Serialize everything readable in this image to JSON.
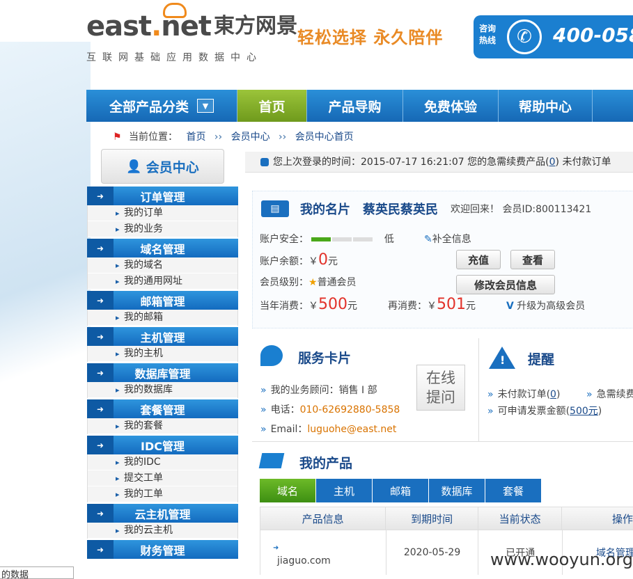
{
  "header": {
    "logo_en": "east",
    "logo_en_dot": ".",
    "logo_en_tail": "net",
    "logo_cn": "東方网景",
    "logo_sub": "互联网基础应用数据中心",
    "slogan": "轻松选择 永久陪伴",
    "hotline_label_1": "咨询",
    "hotline_label_2": "热线",
    "hotline_icon": "phone-icon",
    "hotline_number": "400-058"
  },
  "nav": {
    "items": [
      {
        "label": "全部产品分类",
        "dropdown": "▼"
      },
      {
        "label": "首页"
      },
      {
        "label": "产品导购"
      },
      {
        "label": "免费体验"
      },
      {
        "label": "帮助中心"
      }
    ]
  },
  "breadcrumb": {
    "prefix": "当前位置：",
    "items": [
      "首页",
      "会员中心",
      "会员中心首页"
    ],
    "separator": "›› "
  },
  "sidebar": {
    "title": "会员中心",
    "groups": [
      {
        "title": "订单管理",
        "items": [
          "我的订单",
          "我的业务"
        ]
      },
      {
        "title": "域名管理",
        "items": [
          "我的域名",
          "我的通用网址"
        ]
      },
      {
        "title": "邮箱管理",
        "items": [
          "我的邮箱"
        ]
      },
      {
        "title": "主机管理",
        "items": [
          "我的主机"
        ]
      },
      {
        "title": "数据库管理",
        "items": [
          "我的数据库"
        ]
      },
      {
        "title": "套餐管理",
        "items": [
          "我的套餐"
        ]
      },
      {
        "title": "IDC管理",
        "items": [
          "我的IDC",
          "提交工单",
          "我的工单"
        ]
      },
      {
        "title": "云主机管理",
        "items": [
          "我的云主机"
        ]
      },
      {
        "title": "财务管理",
        "items": []
      }
    ]
  },
  "lastlogin": {
    "text_1": "您上次登录的时间：2015-07-17 16:21:07  您的急需续费产品(",
    "renew_count": "0",
    "text_2": ")  未付款订单"
  },
  "card": {
    "title": "我的名片",
    "name": "蔡英民蔡英民",
    "welcome": "欢迎回来！ 会员ID:800113421",
    "security_label": "账户安全：",
    "security_level": "低",
    "security_fraction": 0.33,
    "complete_info": "补全信息",
    "balance_label": "账户余额：",
    "balance_currency": "￥",
    "balance_value": "0",
    "balance_unit": "元",
    "recharge_button": "充值",
    "view_button": "查看",
    "level_label": "会员级别：",
    "level_value": "普通会员",
    "modify_button": "修改会员信息",
    "year_spend_label": "当年消费：",
    "year_spend_currency": "￥",
    "year_spend_value": "500",
    "year_spend_unit": "元",
    "again_spend_label": "再消费：",
    "again_spend_currency": "￥",
    "again_spend_value": "501",
    "again_spend_unit": "元",
    "upgrade_label": "升级为高级会员",
    "card_icon": "id-card-icon"
  },
  "service": {
    "title": "服务卡片",
    "advisor": "我的业务顾问：销售 I 部",
    "phone_label": "电话：",
    "phone_value": "010-62692880-5858",
    "email_label": "Email：",
    "email_value": "luguohe@east.net",
    "online_qa_1": "在线",
    "online_qa_2": "提问"
  },
  "reminder": {
    "title": "提醒",
    "unpaid_label": "未付款订单(",
    "unpaid_count": "0",
    "unpaid_tail": ")",
    "renew_label": "急需续费",
    "invoice_label": "可申请发票金额(",
    "invoice_value": "500元",
    "invoice_tail": ")"
  },
  "products": {
    "title": "我的产品",
    "tabs": [
      "域名",
      "主机",
      "邮箱",
      "数据库",
      "套餐"
    ],
    "columns": [
      "产品信息",
      "到期时间",
      "当前状态",
      "操作"
    ],
    "rows": [
      {
        "name": "jiaguo.com",
        "expire": "2020-05-29",
        "status": "已开通",
        "action": "域名管理"
      }
    ]
  },
  "watermark": "www.wooyun.org",
  "bottom_left": "的数据"
}
